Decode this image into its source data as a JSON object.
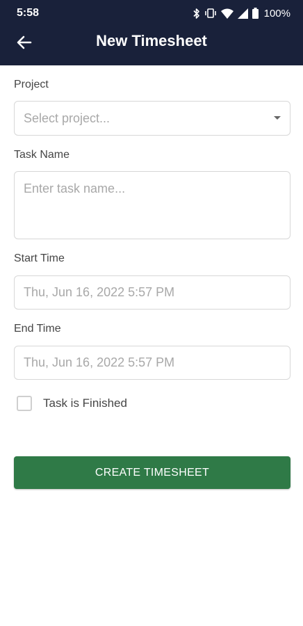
{
  "status_bar": {
    "time": "5:58",
    "battery": "100%",
    "icons": [
      "bluetooth-icon",
      "vibrate-icon",
      "wifi-icon",
      "signal-icon",
      "battery-icon"
    ]
  },
  "app_bar": {
    "title": "New Timesheet",
    "back_icon": "arrow-left-icon"
  },
  "form": {
    "project": {
      "label": "Project",
      "placeholder": "Select project..."
    },
    "task_name": {
      "label": "Task Name",
      "placeholder": "Enter task name..."
    },
    "start_time": {
      "label": "Start Time",
      "value": "Thu, Jun 16, 2022 5:57 PM"
    },
    "end_time": {
      "label": "End Time",
      "value": "Thu, Jun 16, 2022 5:57 PM"
    },
    "finished": {
      "label": "Task is Finished",
      "checked": false
    },
    "submit_label": "CREATE TIMESHEET"
  },
  "colors": {
    "header_bg": "#19213a",
    "button_bg": "#2f7a47",
    "field_border": "#d7d7d7"
  }
}
